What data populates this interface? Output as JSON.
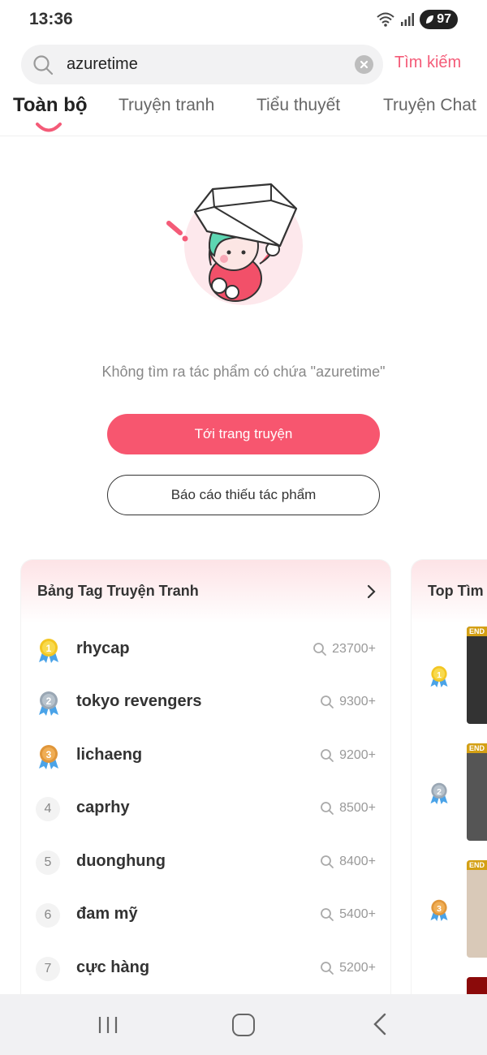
{
  "status_bar": {
    "time": "13:36",
    "battery": "97"
  },
  "search": {
    "value": "azuretime",
    "submit_label": "Tìm kiếm"
  },
  "tabs": [
    {
      "label": "Toàn bộ"
    },
    {
      "label": "Truyện tranh"
    },
    {
      "label": "Tiểu thuyết"
    },
    {
      "label": "Truyện Chat"
    }
  ],
  "empty_state": {
    "message": "Không tìm ra tác phẩm có chứa \"azuretime\"",
    "primary_button": "Tới trang truyện",
    "secondary_button": "Báo cáo thiếu tác phẩm"
  },
  "tag_board": {
    "title": "Bảng Tag Truyện Tranh",
    "items": [
      {
        "rank": "1",
        "term": "rhycap",
        "count": "23700+"
      },
      {
        "rank": "2",
        "term": "tokyo revengers",
        "count": "9300+"
      },
      {
        "rank": "3",
        "term": "lichaeng",
        "count": "9200+"
      },
      {
        "rank": "4",
        "term": "caprhy",
        "count": "8500+"
      },
      {
        "rank": "5",
        "term": "duonghung",
        "count": "8400+"
      },
      {
        "rank": "6",
        "term": "đam mỹ",
        "count": "5400+"
      },
      {
        "rank": "7",
        "term": "cực hàng",
        "count": "5200+"
      }
    ]
  },
  "top_search": {
    "title": "Top Tìm",
    "badge": "END"
  },
  "colors": {
    "accent": "#f7566f",
    "gold": "#f3c623",
    "silver": "#9aa7b4",
    "bronze": "#e0963a"
  }
}
